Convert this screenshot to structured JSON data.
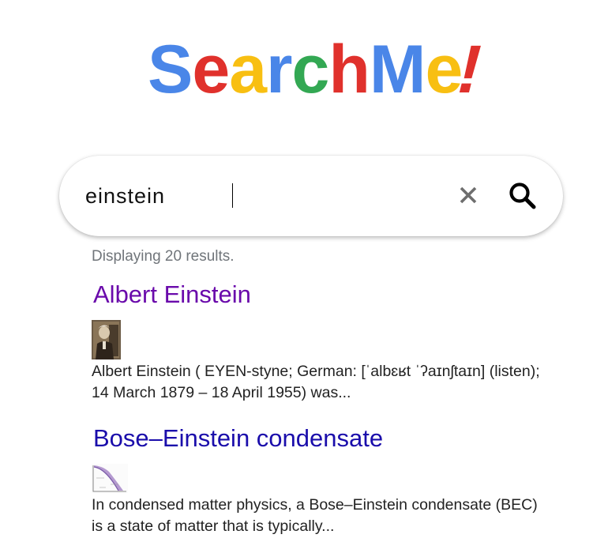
{
  "logo": {
    "letters": [
      {
        "char": "S",
        "color": "#4a86e8"
      },
      {
        "char": "e",
        "color": "#e0312c"
      },
      {
        "char": "a",
        "color": "#f8bf12"
      },
      {
        "char": "r",
        "color": "#4a86e8"
      },
      {
        "char": "c",
        "color": "#33a853"
      },
      {
        "char": "h",
        "color": "#e0312c"
      },
      {
        "char": "M",
        "color": "#4a86e8"
      },
      {
        "char": "e",
        "color": "#f8bf12"
      },
      {
        "char": "!",
        "color": "#e0312c"
      }
    ]
  },
  "search": {
    "value": "einstein",
    "clear_icon": "close-icon",
    "search_icon": "search-icon"
  },
  "results_count": "Displaying 20 results.",
  "results": [
    {
      "title": "Albert Einstein",
      "snippet": "Albert Einstein ( EYEN-styne; German: [ˈalbɛʁt ˈʔaɪnʃtaɪn] (listen); 14 March 1879 – 18 April 1955) was...",
      "visited": true,
      "title_color": "#6a0aab"
    },
    {
      "title": "Bose–Einstein condensate",
      "snippet": "In condensed matter physics, a Bose–Einstein condensate (BEC) is a state of matter that is typically...",
      "visited": false,
      "title_color": "#1a0dab"
    }
  ]
}
